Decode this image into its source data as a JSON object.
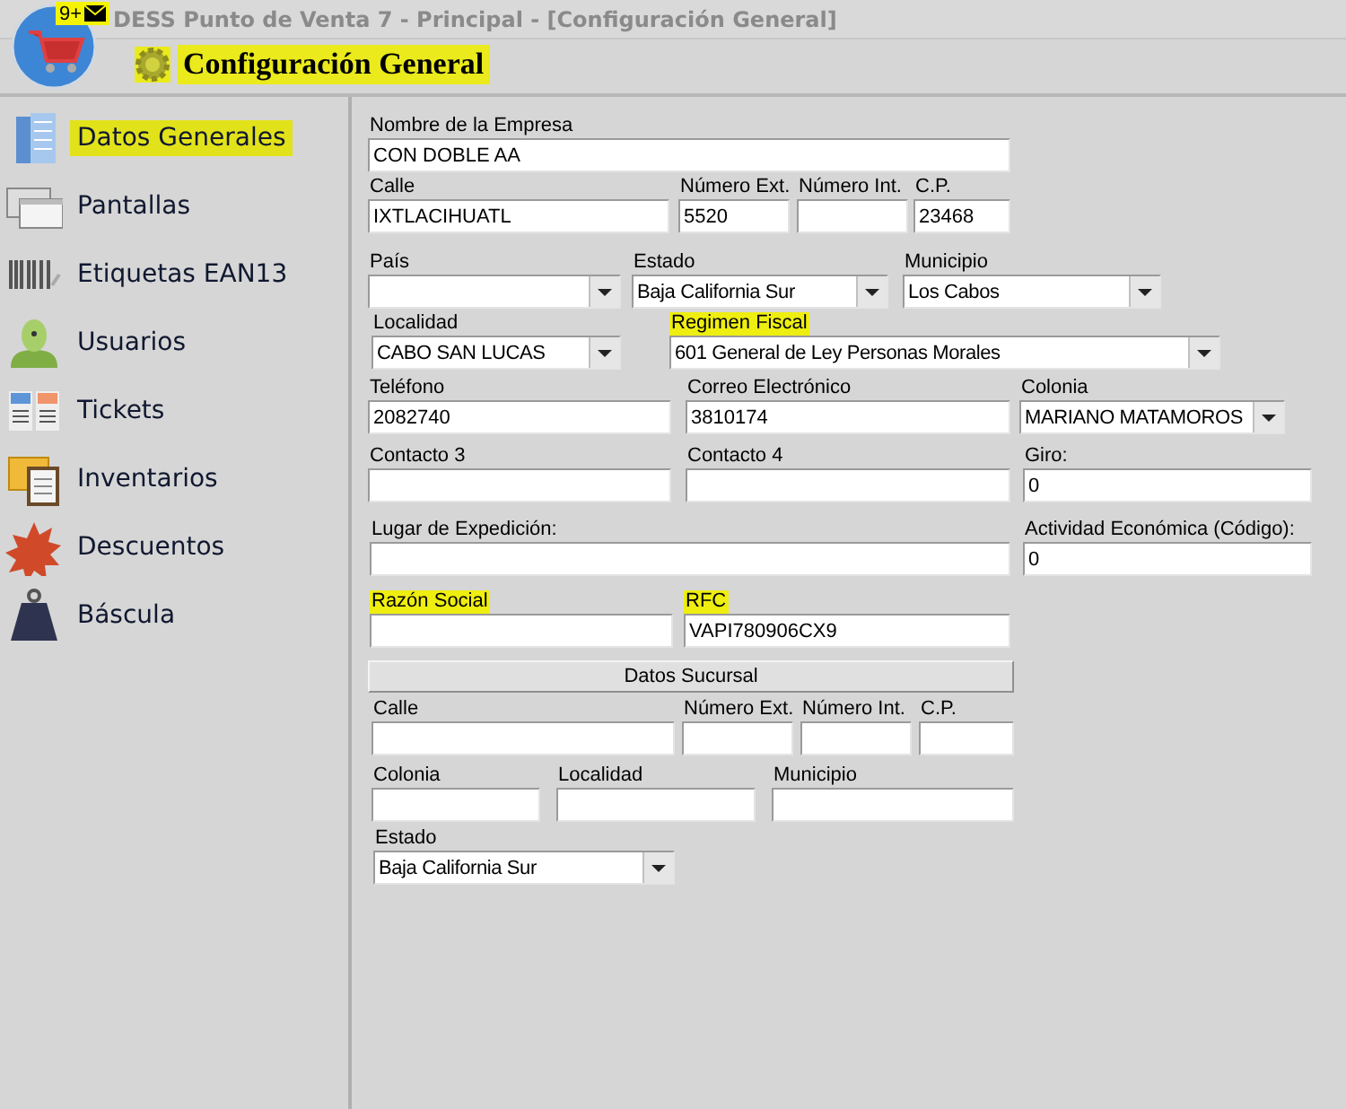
{
  "window": {
    "title": "DESS Punto de Venta 7 - Principal - [Configuración General]",
    "badge": "9+"
  },
  "header": {
    "title": "Configuración General",
    "highlighted": true
  },
  "sidebar": {
    "items": [
      {
        "label": "Datos Generales",
        "highlighted": true
      },
      {
        "label": "Pantallas",
        "highlighted": false
      },
      {
        "label": "Etiquetas EAN13",
        "highlighted": false
      },
      {
        "label": "Usuarios",
        "highlighted": false
      },
      {
        "label": "Tickets",
        "highlighted": false
      },
      {
        "label": "Inventarios",
        "highlighted": false
      },
      {
        "label": "Descuentos",
        "highlighted": false
      },
      {
        "label": "Báscula",
        "highlighted": false
      }
    ]
  },
  "form": {
    "rows": [
      {
        "fields": [
          {
            "label": "Nombre de la Empresa",
            "value": "CON DOBLE AA",
            "kind": "text",
            "highlighted": false
          }
        ]
      },
      {
        "fields": [
          {
            "label": "Calle",
            "value": "IXTLACIHUATL",
            "kind": "text",
            "highlighted": false
          },
          {
            "label": "Número Ext.",
            "value": "5520",
            "kind": "text",
            "highlighted": false
          },
          {
            "label": "Número Int.",
            "kind": "text",
            "highlighted": false
          },
          {
            "label": "C.P.",
            "value": "23468",
            "kind": "text",
            "highlighted": false
          }
        ]
      },
      {
        "fields": [
          {
            "label": "País",
            "kind": "combo",
            "highlighted": false
          },
          {
            "label": "Estado",
            "value": "Baja California Sur",
            "kind": "combo",
            "highlighted": false
          },
          {
            "label": "Municipio",
            "value": "Los Cabos",
            "kind": "combo",
            "highlighted": false
          }
        ]
      },
      {
        "fields": [
          {
            "label": "Localidad",
            "value": "CABO SAN LUCAS",
            "kind": "combo",
            "highlighted": false
          },
          {
            "label": "Regimen Fiscal",
            "value": "601 General de Ley Personas Morales",
            "kind": "combo",
            "highlighted": true
          }
        ]
      },
      {
        "fields": [
          {
            "label": "Teléfono",
            "value": "2082740",
            "kind": "text",
            "highlighted": false
          },
          {
            "label": "Correo Electrónico",
            "value": "3810174",
            "kind": "text",
            "highlighted": false
          },
          {
            "label": "Colonia",
            "value": "MARIANO MATAMOROS",
            "kind": "combo",
            "highlighted": false
          }
        ]
      },
      {
        "fields": [
          {
            "label": "Contacto 3",
            "kind": "text",
            "highlighted": false
          },
          {
            "label": "Contacto 4",
            "kind": "text",
            "highlighted": false
          },
          {
            "label": "Giro:",
            "value": "0",
            "kind": "text",
            "highlighted": false
          }
        ]
      },
      {
        "fields": [
          {
            "label": "Lugar de Expedición:",
            "kind": "text",
            "highlighted": false
          },
          {
            "label": "Actividad Económica (Código):",
            "value": "0",
            "kind": "text",
            "highlighted": false
          }
        ]
      },
      {
        "fields": [
          {
            "label": "Razón Social",
            "kind": "text",
            "highlighted": true
          },
          {
            "label": "RFC",
            "value": "VAPI780906CX9",
            "kind": "text",
            "highlighted": true
          }
        ]
      },
      {
        "button": "Datos Sucursal"
      },
      {
        "fields": [
          {
            "label": "Calle",
            "kind": "text",
            "highlighted": false
          },
          {
            "label": "Número Ext.",
            "kind": "text",
            "highlighted": false
          },
          {
            "label": "Número Int.",
            "kind": "text",
            "highlighted": false
          },
          {
            "label": "C.P.",
            "kind": "text",
            "highlighted": false
          }
        ]
      },
      {
        "fields": [
          {
            "label": "Colonia",
            "kind": "text",
            "highlighted": false
          },
          {
            "label": "Localidad",
            "kind": "text",
            "highlighted": false
          },
          {
            "label": "Municipio",
            "kind": "text",
            "highlighted": false
          }
        ]
      },
      {
        "fields": [
          {
            "label": "Estado",
            "value": "Baja California Sur",
            "kind": "combo",
            "highlighted": false
          }
        ]
      }
    ]
  }
}
